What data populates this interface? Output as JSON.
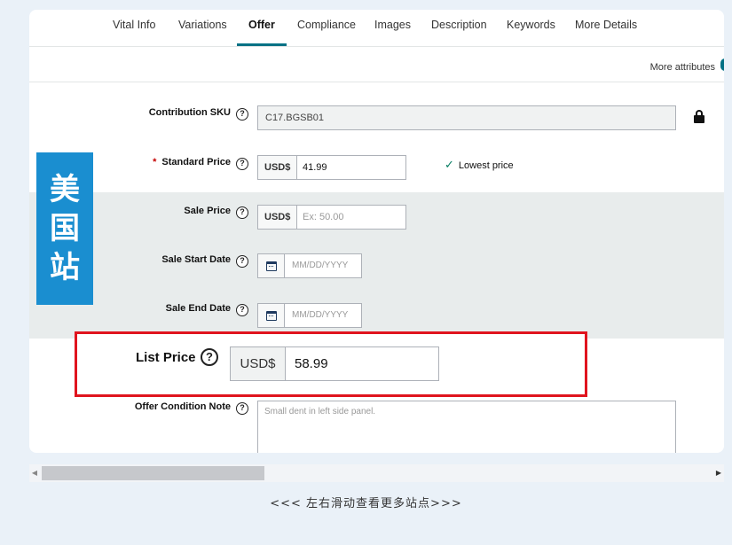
{
  "tabs": [
    {
      "label": "Vital Info"
    },
    {
      "label": "Variations"
    },
    {
      "label": "Offer",
      "active": true
    },
    {
      "label": "Compliance"
    },
    {
      "label": "Images"
    },
    {
      "label": "Description"
    },
    {
      "label": "Keywords"
    },
    {
      "label": "More Details"
    }
  ],
  "more_attributes": "More attributes",
  "fields": {
    "contribution_sku": {
      "label": "Contribution SKU",
      "value": "C17.BGSB01",
      "locked": true
    },
    "standard_price": {
      "label": "Standard Price",
      "required_mark": "*",
      "currency": "USD$",
      "value": "41.99",
      "status": "Lowest price"
    },
    "sale_price": {
      "label": "Sale Price",
      "currency": "USD$",
      "placeholder": "Ex: 50.00"
    },
    "sale_start_date": {
      "label": "Sale Start Date",
      "placeholder": "MM/DD/YYYY"
    },
    "sale_end_date": {
      "label": "Sale End Date",
      "placeholder": "MM/DD/YYYY"
    },
    "list_price": {
      "label": "List Price",
      "currency": "USD$",
      "value": "58.99"
    },
    "offer_condition_note": {
      "label": "Offer Condition Note",
      "placeholder": "Small dent in left side panel."
    }
  },
  "help_glyph": "?",
  "check_glyph": "✓",
  "marketplace_banner": [
    "美",
    "国",
    "站"
  ],
  "scroll_hint": "<<< 左右滑动查看更多站点>>>",
  "scroll_left_glyph": "◀",
  "scroll_right_glyph": "▶",
  "colors": {
    "accent": "#007185",
    "banner": "#1a8ed0",
    "highlight": "#e0141e",
    "check": "#067d62"
  }
}
